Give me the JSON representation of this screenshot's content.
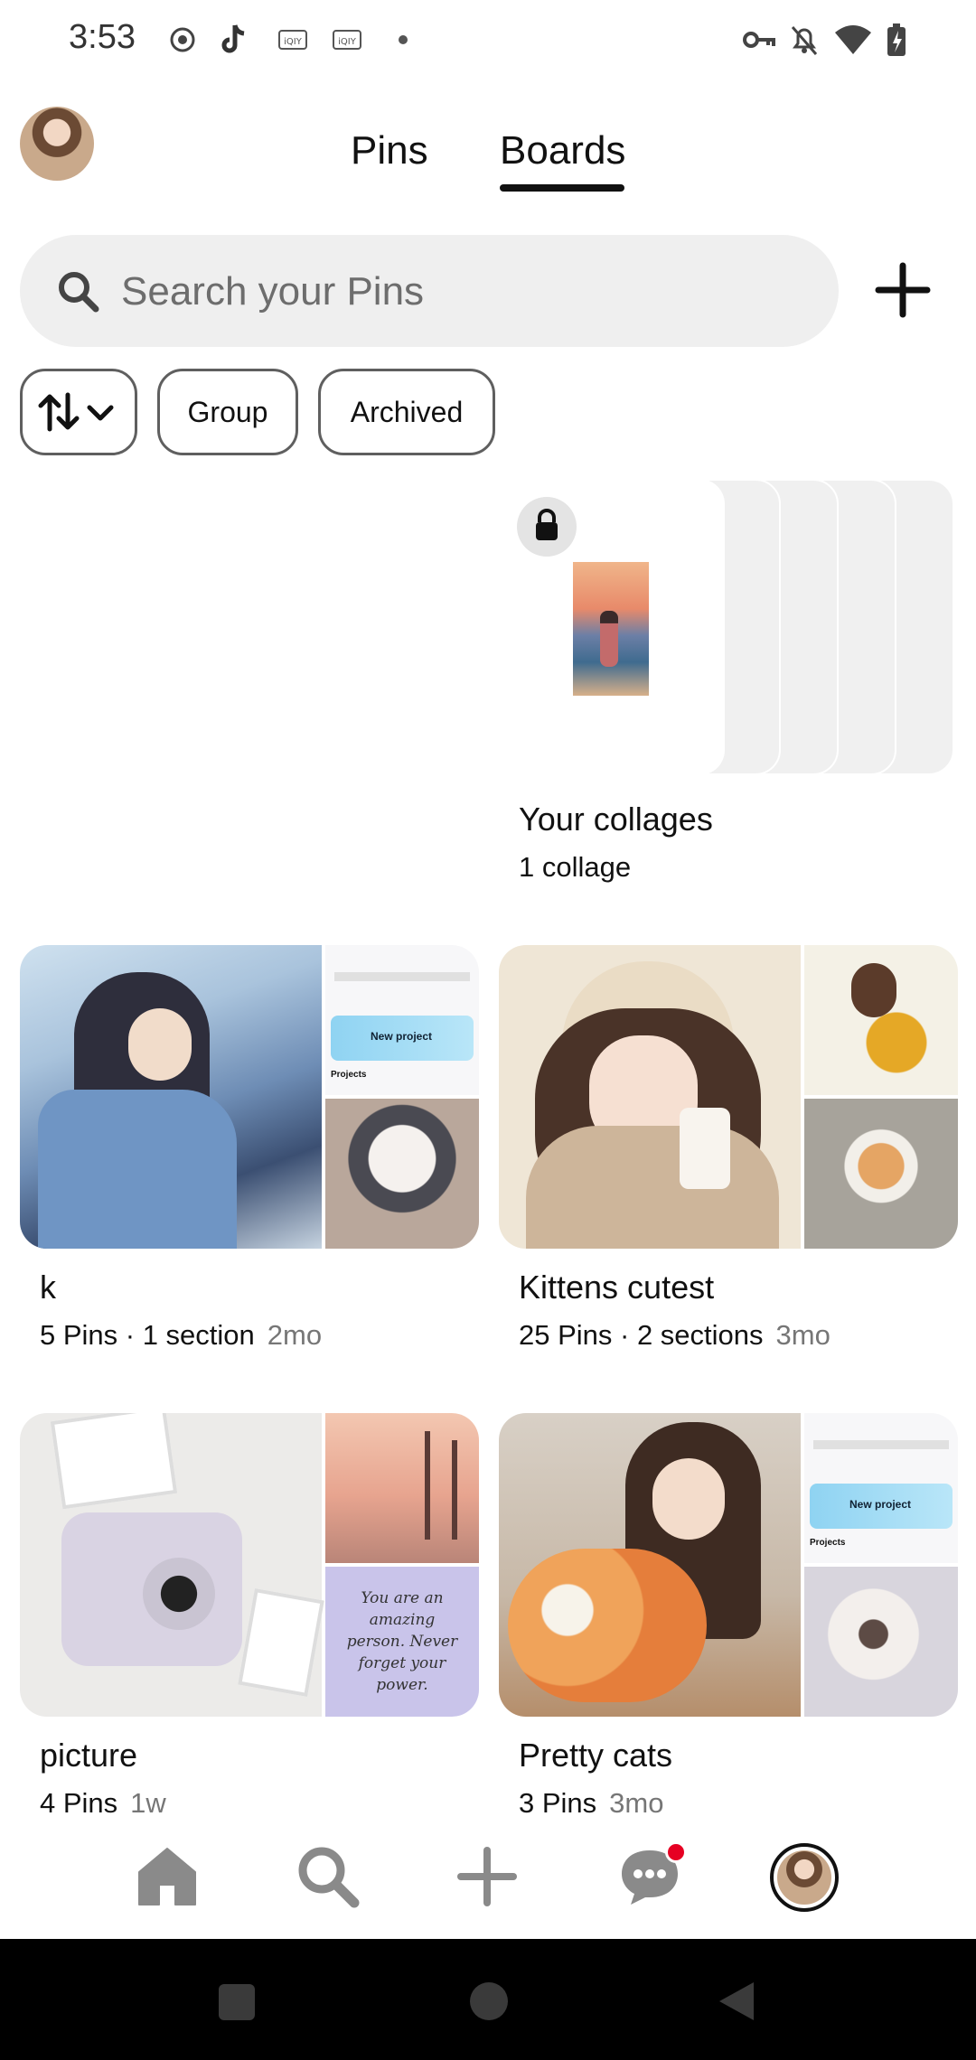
{
  "status_bar": {
    "time": "3:53",
    "left_icons": [
      "record-icon",
      "tiktok-icon",
      "iqiyi-icon",
      "iqiyi-icon",
      "dot-icon"
    ],
    "right_icons": [
      "vpn-key-icon",
      "bell-off-icon",
      "wifi-icon",
      "battery-charging-icon"
    ]
  },
  "header": {
    "tabs": [
      {
        "label": "Pins",
        "active": false
      },
      {
        "label": "Boards",
        "active": true
      }
    ]
  },
  "search": {
    "placeholder": "Search your Pins"
  },
  "filters": {
    "sort_icon": "sort-icon",
    "chips": [
      "Group",
      "Archived"
    ]
  },
  "collages": {
    "title": "Your collages",
    "count": "1 collage",
    "lock_icon": "lock-icon"
  },
  "boards": [
    {
      "title": "k",
      "meta": "5 Pins · 1 section",
      "age": "2mo"
    },
    {
      "title": "Kittens cutest",
      "meta": "25 Pins · 2 sections",
      "age": "3mo"
    },
    {
      "title": "picture",
      "meta": "4 Pins",
      "age": "1w"
    },
    {
      "title": "Pretty cats",
      "meta": "3 Pins",
      "age": "3mo"
    }
  ],
  "thumbnail_text": {
    "new_project": "New project",
    "projects": "Projects",
    "quote": "You are an amazing person. Never forget your power."
  },
  "bottom_nav": [
    "home-icon",
    "search-icon",
    "create-icon",
    "messages-icon",
    "profile-avatar"
  ],
  "colors": {
    "notification_dot": "#e60023",
    "search_bg": "#efefef",
    "accent_blue": "#8fd3f2"
  }
}
